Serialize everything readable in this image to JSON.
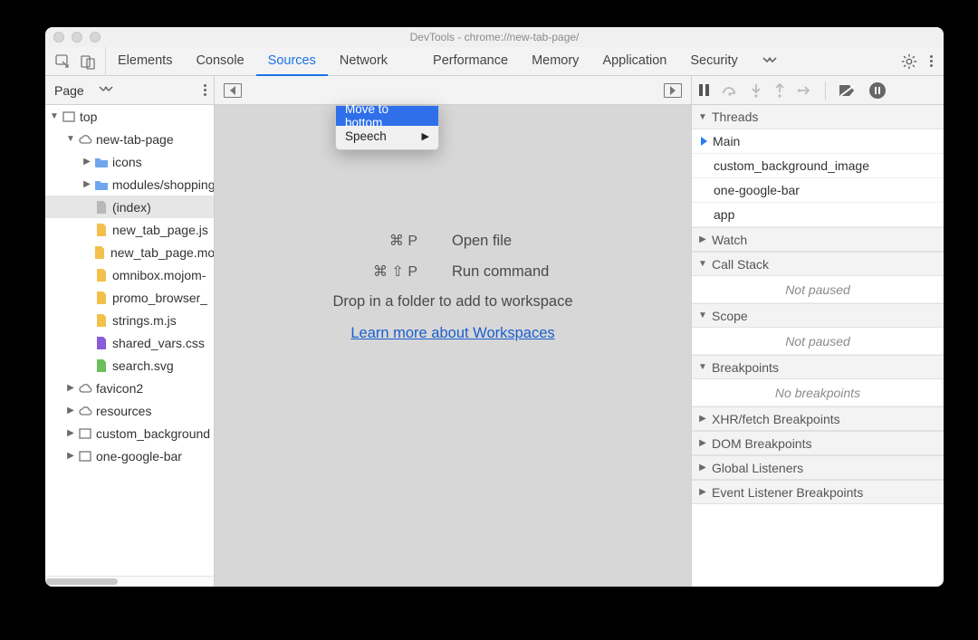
{
  "window": {
    "title": "DevTools - chrome://new-tab-page/"
  },
  "tabs": {
    "items": [
      "Elements",
      "Console",
      "Sources",
      "Network",
      "Performance",
      "Memory",
      "Application",
      "Security"
    ],
    "active_index": 2
  },
  "context_menu": {
    "items": [
      {
        "label": "Move to bottom",
        "highlighted": true,
        "submenu": false
      },
      {
        "label": "Speech",
        "highlighted": false,
        "submenu": true
      }
    ]
  },
  "sidebar": {
    "head_tab": "Page",
    "tree": [
      {
        "depth": 0,
        "twisty": "down",
        "icon": "frame",
        "label": "top"
      },
      {
        "depth": 1,
        "twisty": "down",
        "icon": "cloud",
        "label": "new-tab-page"
      },
      {
        "depth": 2,
        "twisty": "right",
        "icon": "folder",
        "label": "icons"
      },
      {
        "depth": 2,
        "twisty": "right",
        "icon": "folder",
        "label": "modules/shopping"
      },
      {
        "depth": 2,
        "twisty": "",
        "icon": "file-gray",
        "label": "(index)",
        "selected": true
      },
      {
        "depth": 2,
        "twisty": "",
        "icon": "file-yellow",
        "label": "new_tab_page.js"
      },
      {
        "depth": 2,
        "twisty": "",
        "icon": "file-yellow",
        "label": "new_tab_page.mojom"
      },
      {
        "depth": 2,
        "twisty": "",
        "icon": "file-yellow",
        "label": "omnibox.mojom-"
      },
      {
        "depth": 2,
        "twisty": "",
        "icon": "file-yellow",
        "label": "promo_browser_"
      },
      {
        "depth": 2,
        "twisty": "",
        "icon": "file-yellow",
        "label": "strings.m.js"
      },
      {
        "depth": 2,
        "twisty": "",
        "icon": "file-purple",
        "label": "shared_vars.css"
      },
      {
        "depth": 2,
        "twisty": "",
        "icon": "file-green",
        "label": "search.svg"
      },
      {
        "depth": 1,
        "twisty": "right",
        "icon": "cloud",
        "label": "favicon2"
      },
      {
        "depth": 1,
        "twisty": "right",
        "icon": "cloud",
        "label": "resources"
      },
      {
        "depth": 1,
        "twisty": "right",
        "icon": "frame",
        "label": "custom_background"
      },
      {
        "depth": 1,
        "twisty": "right",
        "icon": "frame",
        "label": "one-google-bar"
      }
    ]
  },
  "center": {
    "shortcut1_keys": "⌘ P",
    "shortcut1_label": "Open file",
    "shortcut2_keys": "⌘ ⇧ P",
    "shortcut2_label": "Run command",
    "drop_text": "Drop in a folder to add to workspace",
    "link_text": "Learn more about Workspaces"
  },
  "right": {
    "sections": {
      "threads": {
        "title": "Threads",
        "open": true,
        "rows": [
          "Main",
          "custom_background_image",
          "one-google-bar",
          "app"
        ],
        "active_index": 0
      },
      "watch": {
        "title": "Watch",
        "open": false
      },
      "callstack": {
        "title": "Call Stack",
        "open": true,
        "status": "Not paused"
      },
      "scope": {
        "title": "Scope",
        "open": true,
        "status": "Not paused"
      },
      "breakpoints": {
        "title": "Breakpoints",
        "open": true,
        "status": "No breakpoints"
      },
      "xhr": {
        "title": "XHR/fetch Breakpoints",
        "open": false
      },
      "dom": {
        "title": "DOM Breakpoints",
        "open": false
      },
      "global": {
        "title": "Global Listeners",
        "open": false
      },
      "event": {
        "title": "Event Listener Breakpoints",
        "open": false
      }
    }
  }
}
